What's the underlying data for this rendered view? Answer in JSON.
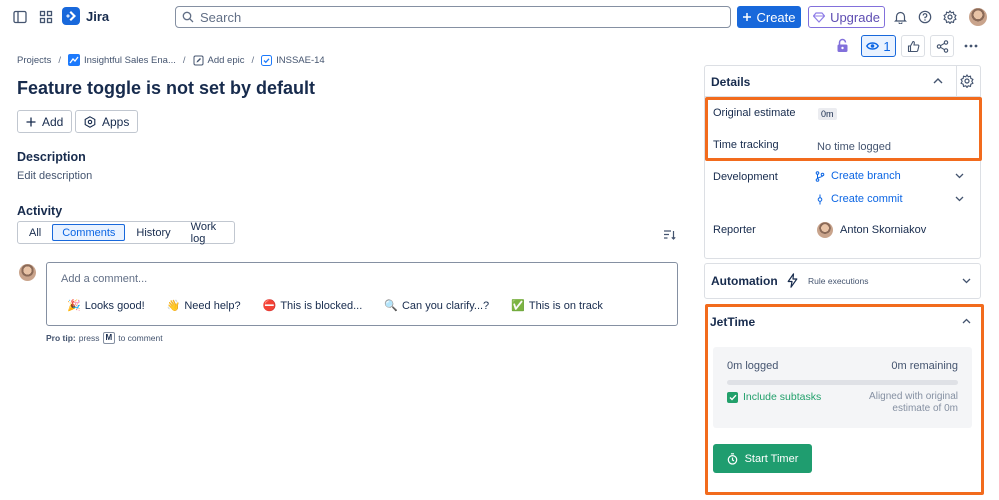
{
  "topbar": {
    "app_name": "Jira",
    "search_placeholder": "Search",
    "create_label": "Create",
    "upgrade_label": "Upgrade"
  },
  "issue_actions": {
    "watchers_count": "1"
  },
  "breadcrumbs": [
    {
      "label": "Projects"
    },
    {
      "label": "Insightful Sales Ena..."
    },
    {
      "label": "Add epic"
    },
    {
      "label": "INSSAE-14"
    }
  ],
  "issue": {
    "title": "Feature toggle is not set by default",
    "add_label": "Add",
    "apps_label": "Apps"
  },
  "description": {
    "heading": "Description",
    "placeholder": "Edit description"
  },
  "activity": {
    "heading": "Activity",
    "tabs": [
      {
        "label": "All",
        "active": false
      },
      {
        "label": "Comments",
        "active": true
      },
      {
        "label": "History",
        "active": false
      },
      {
        "label": "Work log",
        "active": false
      }
    ],
    "comment_placeholder": "Add a comment...",
    "quick_replies": [
      {
        "emoji": "🎉",
        "label": "Looks good!"
      },
      {
        "emoji": "👋",
        "label": "Need help?"
      },
      {
        "emoji": "⛔",
        "label": "This is blocked..."
      },
      {
        "emoji": "🔍",
        "label": "Can you clarify...?"
      },
      {
        "emoji": "✅",
        "label": "This is on track"
      }
    ],
    "pro_tip_prefix": "Pro tip:",
    "pro_tip_press": "press",
    "pro_tip_key": "M",
    "pro_tip_suffix": "to comment"
  },
  "details": {
    "heading": "Details",
    "original_estimate_label": "Original estimate",
    "original_estimate_value": "0m",
    "time_tracking_label": "Time tracking",
    "time_tracking_value": "No time logged",
    "development_label": "Development",
    "create_branch_label": "Create branch",
    "create_commit_label": "Create commit",
    "reporter_label": "Reporter",
    "reporter_name": "Anton Skorniakov"
  },
  "automation": {
    "heading": "Automation",
    "rule_executions_label": "Rule executions"
  },
  "jettime": {
    "heading": "JetTime",
    "logged_label": "0m logged",
    "remaining_label": "0m remaining",
    "progress_fraction": 0,
    "include_subtasks_label": "Include subtasks",
    "include_subtasks_checked": true,
    "aligned_line1": "Aligned with original",
    "aligned_line2": "estimate of 0m",
    "start_timer_label": "Start Timer"
  },
  "colors": {
    "primary": "#1868db",
    "highlight_outline": "#f26b1d",
    "timer_green": "#1f9d6f"
  }
}
